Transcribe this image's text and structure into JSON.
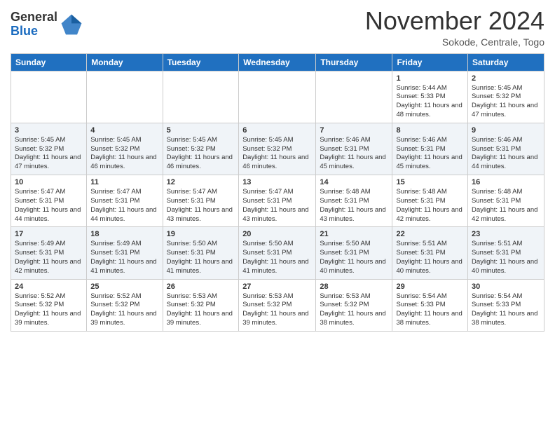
{
  "header": {
    "logo_general": "General",
    "logo_blue": "Blue",
    "month_title": "November 2024",
    "location": "Sokode, Centrale, Togo"
  },
  "days_of_week": [
    "Sunday",
    "Monday",
    "Tuesday",
    "Wednesday",
    "Thursday",
    "Friday",
    "Saturday"
  ],
  "weeks": [
    [
      {
        "day": "",
        "info": ""
      },
      {
        "day": "",
        "info": ""
      },
      {
        "day": "",
        "info": ""
      },
      {
        "day": "",
        "info": ""
      },
      {
        "day": "",
        "info": ""
      },
      {
        "day": "1",
        "info": "Sunrise: 5:44 AM\nSunset: 5:33 PM\nDaylight: 11 hours and 48 minutes."
      },
      {
        "day": "2",
        "info": "Sunrise: 5:45 AM\nSunset: 5:32 PM\nDaylight: 11 hours and 47 minutes."
      }
    ],
    [
      {
        "day": "3",
        "info": "Sunrise: 5:45 AM\nSunset: 5:32 PM\nDaylight: 11 hours and 47 minutes."
      },
      {
        "day": "4",
        "info": "Sunrise: 5:45 AM\nSunset: 5:32 PM\nDaylight: 11 hours and 46 minutes."
      },
      {
        "day": "5",
        "info": "Sunrise: 5:45 AM\nSunset: 5:32 PM\nDaylight: 11 hours and 46 minutes."
      },
      {
        "day": "6",
        "info": "Sunrise: 5:45 AM\nSunset: 5:32 PM\nDaylight: 11 hours and 46 minutes."
      },
      {
        "day": "7",
        "info": "Sunrise: 5:46 AM\nSunset: 5:31 PM\nDaylight: 11 hours and 45 minutes."
      },
      {
        "day": "8",
        "info": "Sunrise: 5:46 AM\nSunset: 5:31 PM\nDaylight: 11 hours and 45 minutes."
      },
      {
        "day": "9",
        "info": "Sunrise: 5:46 AM\nSunset: 5:31 PM\nDaylight: 11 hours and 44 minutes."
      }
    ],
    [
      {
        "day": "10",
        "info": "Sunrise: 5:47 AM\nSunset: 5:31 PM\nDaylight: 11 hours and 44 minutes."
      },
      {
        "day": "11",
        "info": "Sunrise: 5:47 AM\nSunset: 5:31 PM\nDaylight: 11 hours and 44 minutes."
      },
      {
        "day": "12",
        "info": "Sunrise: 5:47 AM\nSunset: 5:31 PM\nDaylight: 11 hours and 43 minutes."
      },
      {
        "day": "13",
        "info": "Sunrise: 5:47 AM\nSunset: 5:31 PM\nDaylight: 11 hours and 43 minutes."
      },
      {
        "day": "14",
        "info": "Sunrise: 5:48 AM\nSunset: 5:31 PM\nDaylight: 11 hours and 43 minutes."
      },
      {
        "day": "15",
        "info": "Sunrise: 5:48 AM\nSunset: 5:31 PM\nDaylight: 11 hours and 42 minutes."
      },
      {
        "day": "16",
        "info": "Sunrise: 5:48 AM\nSunset: 5:31 PM\nDaylight: 11 hours and 42 minutes."
      }
    ],
    [
      {
        "day": "17",
        "info": "Sunrise: 5:49 AM\nSunset: 5:31 PM\nDaylight: 11 hours and 42 minutes."
      },
      {
        "day": "18",
        "info": "Sunrise: 5:49 AM\nSunset: 5:31 PM\nDaylight: 11 hours and 41 minutes."
      },
      {
        "day": "19",
        "info": "Sunrise: 5:50 AM\nSunset: 5:31 PM\nDaylight: 11 hours and 41 minutes."
      },
      {
        "day": "20",
        "info": "Sunrise: 5:50 AM\nSunset: 5:31 PM\nDaylight: 11 hours and 41 minutes."
      },
      {
        "day": "21",
        "info": "Sunrise: 5:50 AM\nSunset: 5:31 PM\nDaylight: 11 hours and 40 minutes."
      },
      {
        "day": "22",
        "info": "Sunrise: 5:51 AM\nSunset: 5:31 PM\nDaylight: 11 hours and 40 minutes."
      },
      {
        "day": "23",
        "info": "Sunrise: 5:51 AM\nSunset: 5:31 PM\nDaylight: 11 hours and 40 minutes."
      }
    ],
    [
      {
        "day": "24",
        "info": "Sunrise: 5:52 AM\nSunset: 5:32 PM\nDaylight: 11 hours and 39 minutes."
      },
      {
        "day": "25",
        "info": "Sunrise: 5:52 AM\nSunset: 5:32 PM\nDaylight: 11 hours and 39 minutes."
      },
      {
        "day": "26",
        "info": "Sunrise: 5:53 AM\nSunset: 5:32 PM\nDaylight: 11 hours and 39 minutes."
      },
      {
        "day": "27",
        "info": "Sunrise: 5:53 AM\nSunset: 5:32 PM\nDaylight: 11 hours and 39 minutes."
      },
      {
        "day": "28",
        "info": "Sunrise: 5:53 AM\nSunset: 5:32 PM\nDaylight: 11 hours and 38 minutes."
      },
      {
        "day": "29",
        "info": "Sunrise: 5:54 AM\nSunset: 5:33 PM\nDaylight: 11 hours and 38 minutes."
      },
      {
        "day": "30",
        "info": "Sunrise: 5:54 AM\nSunset: 5:33 PM\nDaylight: 11 hours and 38 minutes."
      }
    ]
  ]
}
